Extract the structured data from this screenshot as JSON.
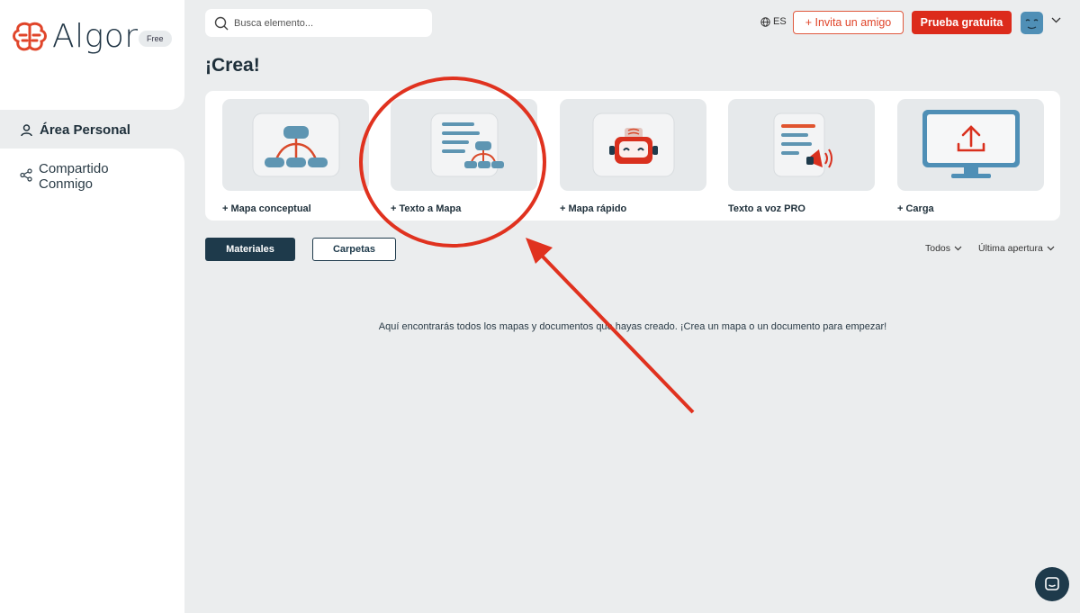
{
  "app": {
    "name": "Algor",
    "plan_badge": "Free"
  },
  "sidebar": {
    "items": [
      {
        "label": "Área Personal",
        "icon": "user-icon",
        "active": true
      },
      {
        "label": "Compartido Conmigo",
        "icon": "share-icon",
        "active": false
      }
    ]
  },
  "topbar": {
    "search_placeholder": "Busca elemento...",
    "language": "ES",
    "invite_label": "+ Invita un amigo",
    "trial_label": "Prueba gratuita"
  },
  "main": {
    "title": "¡Crea!",
    "create_cards": [
      {
        "label": "+ Mapa conceptual",
        "icon": "concept-map-icon"
      },
      {
        "label": "+ Texto a Mapa",
        "icon": "text-to-map-icon"
      },
      {
        "label": "+ Mapa rápido",
        "icon": "robot-icon"
      },
      {
        "label": "Texto a voz PRO",
        "icon": "text-to-speech-icon"
      },
      {
        "label": "+ Carga",
        "icon": "upload-monitor-icon"
      }
    ],
    "tabs": [
      {
        "label": "Materiales",
        "active": true
      },
      {
        "label": "Carpetas",
        "active": false
      }
    ],
    "filters": {
      "type_label": "Todos",
      "sort_label": "Última apertura"
    },
    "empty_message": "Aquí encontrarás todos los mapas y documentos que hayas creado. ¡Crea un mapa o un documento para empezar!"
  },
  "colors": {
    "brand_dark": "#1e3a4b",
    "brand_red": "#dc2b1b",
    "annotation_red": "#e0321f",
    "background": "#ebedee"
  }
}
